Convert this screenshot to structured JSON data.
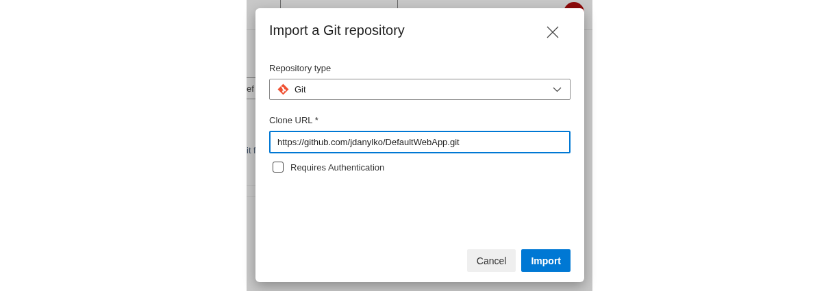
{
  "background_page": {
    "fragments": [
      "ef",
      "it f"
    ]
  },
  "dialog": {
    "title": "Import a Git repository",
    "fields": [
      {
        "kind": "select",
        "label": "Repository type",
        "value": "Git",
        "focused": false
      },
      {
        "kind": "text",
        "label": "Clone URL *",
        "value": "https://github.com/jdanylko/DefaultWebApp.git",
        "focused": true
      }
    ],
    "checkbox": {
      "label": "Requires Authentication",
      "checked": false
    },
    "buttons": [
      {
        "label": "Cancel",
        "kind": "secondary"
      },
      {
        "label": "Import",
        "kind": "primary"
      }
    ]
  }
}
